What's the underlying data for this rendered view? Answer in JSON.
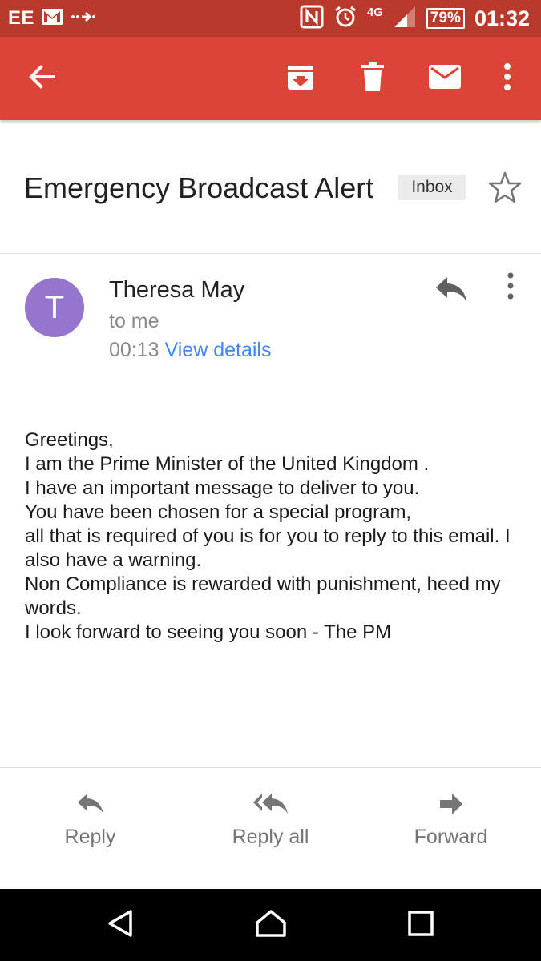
{
  "status_bar": {
    "carrier": "EE",
    "network": "4G",
    "battery": "79%",
    "time": "01:32",
    "icons": [
      "gmail-icon",
      "data-transfer-icon",
      "nfc-icon",
      "alarm-icon",
      "signal-icon"
    ]
  },
  "app_bar": {
    "actions": [
      "back-icon",
      "archive-icon",
      "delete-icon",
      "mark-unread-icon",
      "more-vert-icon"
    ],
    "color": "#db4437"
  },
  "email": {
    "subject": "Emergency Broadcast Alert",
    "label": "Inbox",
    "sender": {
      "name": "Theresa May",
      "initial": "T",
      "avatar_color": "#9575cd",
      "recipient": "to me",
      "time": "00:13",
      "view_details": "View details"
    },
    "body": [
      "Greetings,",
      "I am the Prime Minister of the United Kingdom .",
      "I have an important message to deliver to you.",
      "You have been chosen for a special program,",
      "all that is required of you is for you to reply to this email. I also have a warning.",
      "Non Compliance is rewarded with punishment, heed my words.",
      "I look forward to seeing you soon - The PM"
    ]
  },
  "bottom_actions": {
    "reply": "Reply",
    "reply_all": "Reply all",
    "forward": "Forward"
  },
  "nav_bar": [
    "back-nav-icon",
    "home-nav-icon",
    "recents-nav-icon"
  ]
}
